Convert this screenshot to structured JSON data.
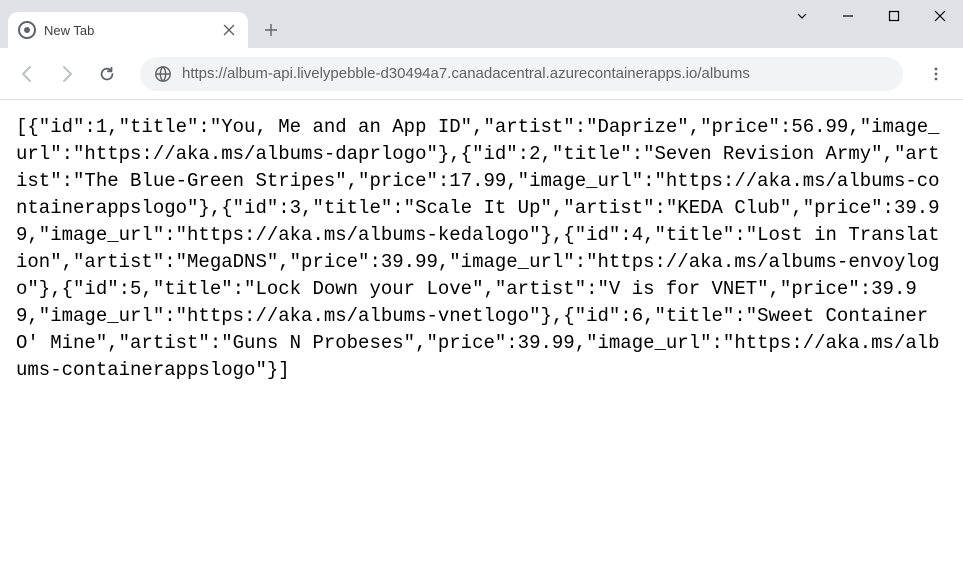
{
  "tab": {
    "title": "New Tab"
  },
  "url": {
    "prefix": "https://",
    "host": "album-api.livelypebble-d30494a7.canadacentral.azurecontainerapps.io",
    "slash": "/",
    "path": "albums"
  },
  "body_text": "[{\"id\":1,\"title\":\"You, Me and an App ID\",\"artist\":\"Daprize\",\"price\":56.99,\"image_url\":\"https://aka.ms/albums-daprlogo\"},{\"id\":2,\"title\":\"Seven Revision Army\",\"artist\":\"The Blue-Green Stripes\",\"price\":17.99,\"image_url\":\"https://aka.ms/albums-containerappslogo\"},{\"id\":3,\"title\":\"Scale It Up\",\"artist\":\"KEDA Club\",\"price\":39.99,\"image_url\":\"https://aka.ms/albums-kedalogo\"},{\"id\":4,\"title\":\"Lost in Translation\",\"artist\":\"MegaDNS\",\"price\":39.99,\"image_url\":\"https://aka.ms/albums-envoylogo\"},{\"id\":5,\"title\":\"Lock Down your Love\",\"artist\":\"V is for VNET\",\"price\":39.99,\"image_url\":\"https://aka.ms/albums-vnetlogo\"},{\"id\":6,\"title\":\"Sweet Container O' Mine\",\"artist\":\"Guns N Probeses\",\"price\":39.99,\"image_url\":\"https://aka.ms/albums-containerappslogo\"}]"
}
